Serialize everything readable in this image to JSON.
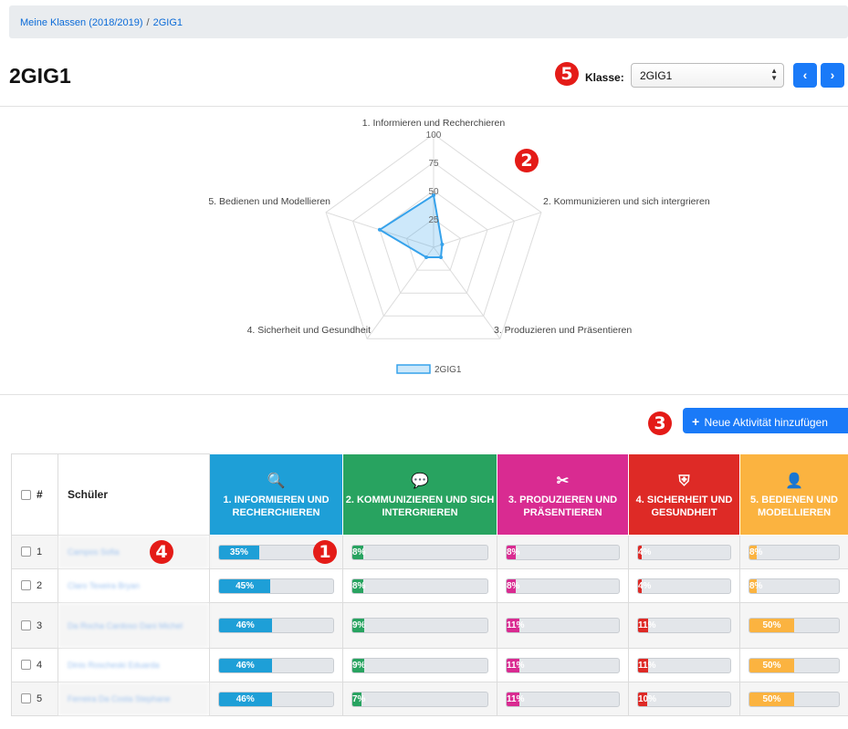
{
  "breadcrumb": {
    "classes_link": "Meine Klassen (2018/2019)",
    "separator": "/",
    "current": "2GIG1"
  },
  "page_title": "2GIG1",
  "badges": [
    "1",
    "2",
    "3",
    "4",
    "5"
  ],
  "class_selector": {
    "label": "Klasse:",
    "value": "2GIG1",
    "prev_icon": "chevron-left-icon",
    "next_icon": "chevron-right-icon",
    "prev_glyph": "‹",
    "next_glyph": "›"
  },
  "chart_data": {
    "type": "radar",
    "axes": [
      "1. Informieren und Recherchieren",
      "2. Kommunizieren und sich intergrieren",
      "3. Produzieren und Präsentieren",
      "4. Sicherheit und Gesundheit",
      "5. Bedienen und Modellieren"
    ],
    "ticks": [
      "25",
      "50",
      "75",
      "100"
    ],
    "range": [
      0,
      100
    ],
    "series": [
      {
        "name": "2GIG1",
        "values": [
          46,
          8,
          11,
          11,
          50
        ],
        "color": "#36a2eb"
      }
    ],
    "legend_position": "bottom"
  },
  "actions": {
    "add_activity_label": "Neue Aktivität hinzufügen",
    "add_activity_icon": "plus-icon"
  },
  "table": {
    "header_number": "#",
    "header_student": "Schüler",
    "competencies": [
      {
        "label": "1. Informieren und Recherchieren",
        "icon": "search-icon",
        "glyph": "🔍",
        "color": "#1e9fd7"
      },
      {
        "label": "2. Kommunizieren und sich intergrieren",
        "icon": "chat-icon",
        "glyph": "💬",
        "color": "#28a360"
      },
      {
        "label": "3. Produzieren und Präsentieren",
        "icon": "tools-icon",
        "glyph": "✂",
        "color": "#d92b91"
      },
      {
        "label": "4. Sicherheit und Gesundheit",
        "icon": "shield-icon",
        "glyph": "⛨",
        "color": "#de2a26"
      },
      {
        "label": "5. Bedienen und Modellieren",
        "icon": "user-gear-icon",
        "glyph": "👤",
        "color": "#fbb340"
      }
    ],
    "rows": [
      {
        "num": "1",
        "student": "Campos Sofia",
        "values": [
          35,
          8,
          8,
          4,
          8
        ],
        "labels": [
          "35%",
          "8%",
          "8%",
          "4%",
          "8%"
        ]
      },
      {
        "num": "2",
        "student": "Claro Texeira Bryan",
        "values": [
          45,
          8,
          8,
          4,
          8
        ],
        "labels": [
          "45%",
          "8%",
          "8%",
          "4%",
          "8%"
        ]
      },
      {
        "num": "3",
        "student": "Da Rocha Cardoso Dani Michel",
        "values": [
          46,
          9,
          11,
          11,
          50
        ],
        "labels": [
          "46%",
          "9%",
          "11%",
          "11%",
          "50%"
        ]
      },
      {
        "num": "4",
        "student": "Dinis Roscheski Eduarda",
        "values": [
          46,
          9,
          11,
          11,
          50
        ],
        "labels": [
          "46%",
          "9%",
          "11%",
          "11%",
          "50%"
        ]
      },
      {
        "num": "5",
        "student": "Ferreira Da Costa Stephane",
        "values": [
          46,
          7,
          11,
          10,
          50
        ],
        "labels": [
          "46%",
          "7%",
          "11%",
          "10%",
          "50%"
        ]
      }
    ]
  }
}
